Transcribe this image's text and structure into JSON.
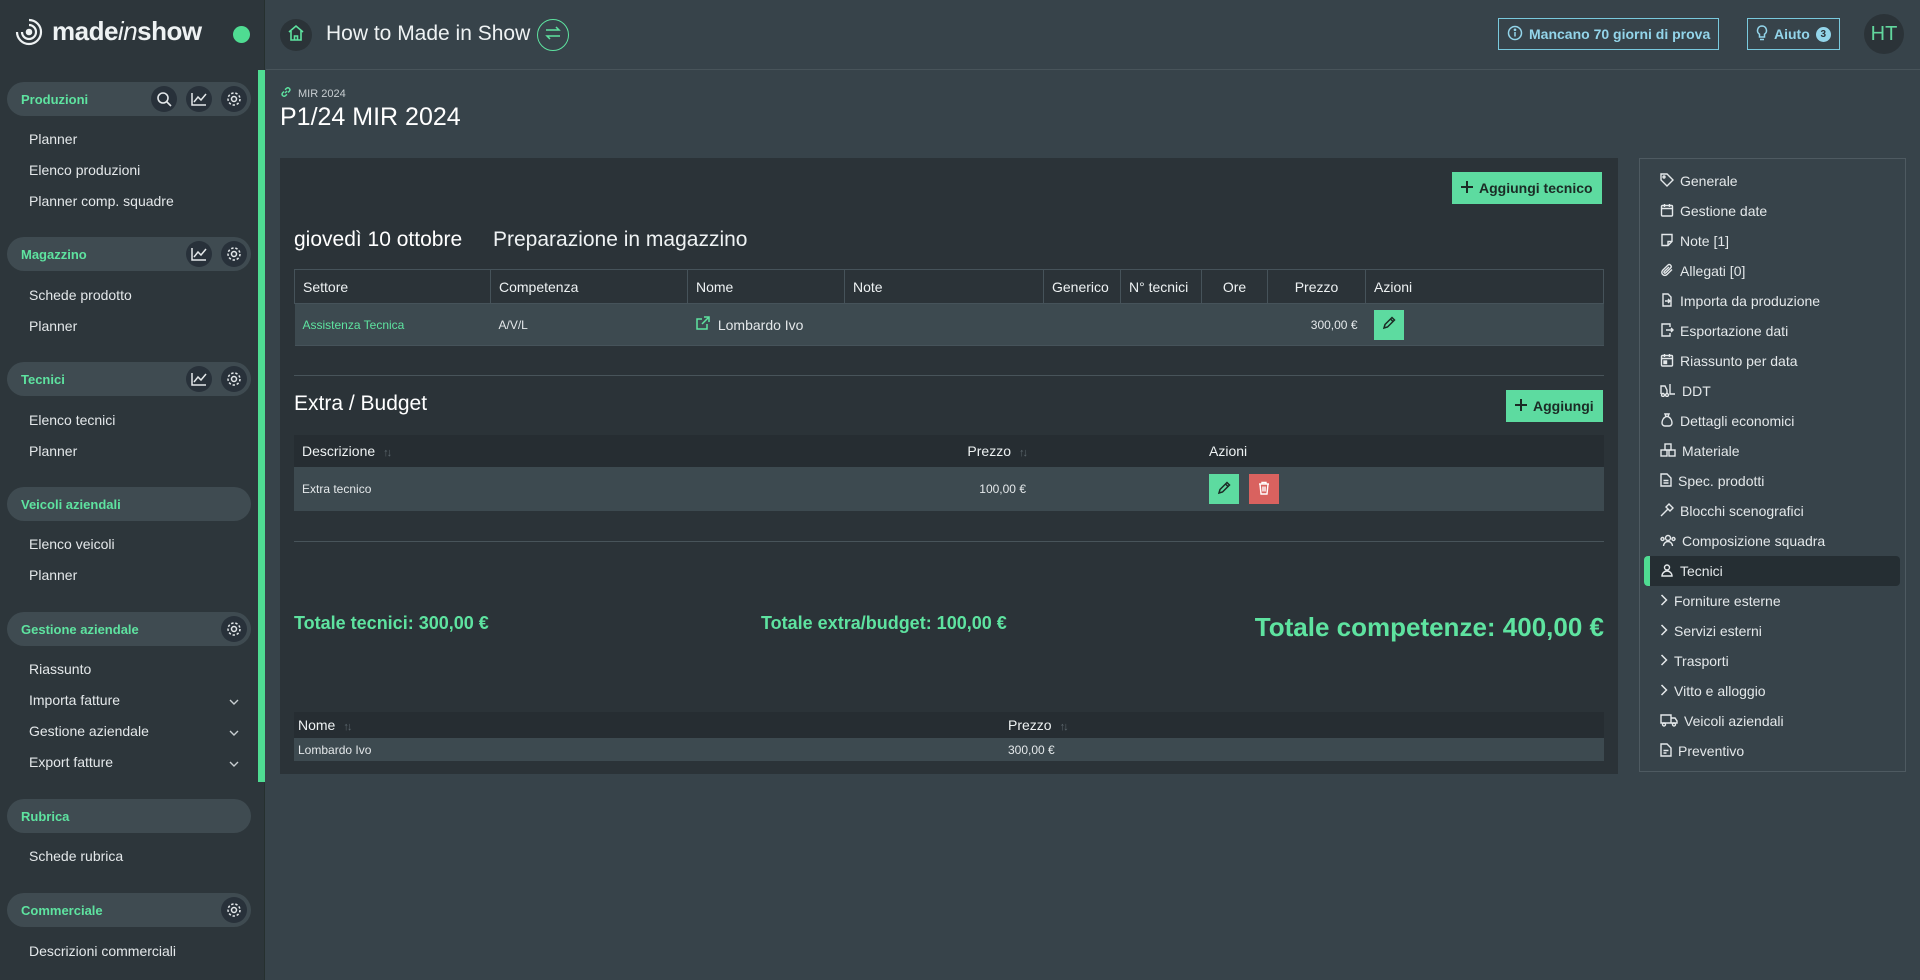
{
  "app": {
    "brand_a": "made",
    "brand_i": "in",
    "brand_b": "show"
  },
  "sidebar": {
    "groups": [
      {
        "title": "Produzioni",
        "items": [
          "Planner",
          "Elenco produzioni",
          "Planner comp. squadre"
        ]
      },
      {
        "title": "Magazzino",
        "items": [
          "Schede prodotto",
          "Planner"
        ]
      },
      {
        "title": "Tecnici",
        "items": [
          "Elenco tecnici",
          "Planner"
        ]
      },
      {
        "title": "Veicoli aziendali",
        "items": [
          "Elenco veicoli",
          "Planner"
        ]
      },
      {
        "title": "Gestione aziendale",
        "items": [
          "Riassunto",
          "Importa fatture",
          "Gestione aziendale",
          "Export fatture"
        ]
      },
      {
        "title": "Rubrica",
        "items": [
          "Schede rubrica"
        ]
      },
      {
        "title": "Commerciale",
        "items": [
          "Descrizioni commerciali"
        ]
      }
    ]
  },
  "topbar": {
    "title": "How to Made in Show",
    "trial": "Mancano 70 giorni di prova",
    "help": "Aiuto",
    "help_count": "3",
    "avatar": "HT"
  },
  "header": {
    "breadcrumb": "MIR 2024",
    "title": "P1/24 MIR 2024"
  },
  "main": {
    "add_tech_label": "Aggiungi tecnico",
    "date": "giovedì 10 ottobre",
    "subtitle": "Preparazione in magazzino",
    "tech_table": {
      "headers": [
        "Settore",
        "Competenza",
        "Nome",
        "Note",
        "Generico",
        "N° tecnici",
        "Ore",
        "Prezzo",
        "Azioni"
      ],
      "row": {
        "settore": "Assistenza Tecnica",
        "competenza": "A/V/L",
        "nome": "Lombardo Ivo",
        "note": "",
        "generico": "",
        "ntecnici": "",
        "ore": "",
        "prezzo": "300,00 €"
      }
    },
    "extra_title": "Extra / Budget",
    "add_label": "Aggiungi",
    "extra_table": {
      "headers": [
        "Descrizione",
        "Prezzo",
        "Azioni"
      ],
      "row": {
        "descrizione": "Extra tecnico",
        "prezzo": "100,00 €"
      }
    },
    "totals": {
      "tecnici": "Totale tecnici: 300,00 €",
      "extra": "Totale extra/budget: 100,00 €",
      "competenze": "Totale competenze: 400,00 €"
    },
    "summary_table": {
      "headers": [
        "Nome",
        "Prezzo"
      ],
      "row": {
        "nome": "Lombardo Ivo",
        "prezzo": "300,00 €"
      }
    }
  },
  "rightnav": {
    "items": [
      "Generale",
      "Gestione date",
      "Note [1]",
      "Allegati [0]",
      "Importa da produzione",
      "Esportazione dati",
      "Riassunto per data",
      "DDT",
      "Dettagli economici",
      "Materiale",
      "Spec. prodotti",
      "Blocchi scenografici",
      "Composizione squadra",
      "Tecnici",
      "Forniture esterne",
      "Servizi esterni",
      "Trasporti",
      "Vitto e alloggio",
      "Veicoli aziendali",
      "Preventivo"
    ],
    "active": "Tecnici"
  },
  "colors": {
    "accent": "#4fdc92",
    "green_text": "#5ee3a0",
    "danger": "#d9625f",
    "info": "#79c9dd"
  }
}
